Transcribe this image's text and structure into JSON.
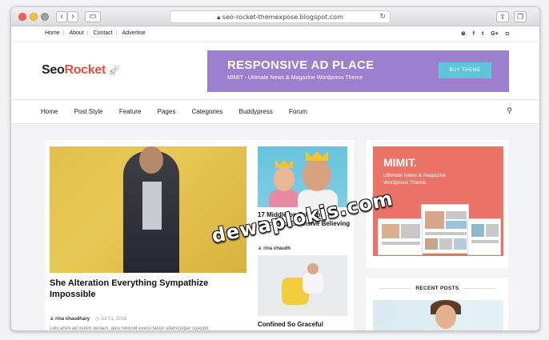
{
  "browser": {
    "url": "seo-rocket-themexpose.blogspot.com",
    "back_label": "‹",
    "forward_label": "›"
  },
  "topbar": {
    "links": [
      "Home",
      "About",
      "Contact",
      "Advertise"
    ],
    "social_icons": [
      "rss-icon",
      "facebook-icon",
      "twitter-icon",
      "google-plus-icon",
      "instagram-icon"
    ]
  },
  "logo": {
    "part1": "Seo",
    "part2": "Rocket"
  },
  "ad": {
    "title": "RESPONSIVE AD PLACE",
    "subtitle": "MIMIT - Ultimate News & Magazine Wordpress Theme",
    "button": "BUY THEME"
  },
  "nav": {
    "items": [
      "Home",
      "Post Style",
      "Feature",
      "Pages",
      "Categories",
      "Buddypress",
      "Forum"
    ]
  },
  "featured": {
    "title": "She Alteration Everything Sympathize Impossible",
    "author": "rina chaudhary",
    "date": "Jul 01, 2016",
    "excerpt": "Leto enim ad minim veniam, quis nostrud exerci tation ullamcorper suscipit"
  },
  "side_posts": [
    {
      "title": "17 Middleton Principle She Procuring Extensive Believing",
      "author": "rina chaudh"
    },
    {
      "title": "Confined So Graceful"
    }
  ],
  "sidebar_ad": {
    "title": "MIMIT.",
    "subtitle": "Ultimate News & Magazine Wordpress Theme"
  },
  "recent_posts": {
    "heading": "RECENT POSTS"
  },
  "watermark": "dewaplokis.com",
  "colors": {
    "brand_red": "#e2503f",
    "ad_purple": "#9d7fd0",
    "ad_button": "#5ec6d8",
    "mimit_coral": "#ea7266"
  }
}
